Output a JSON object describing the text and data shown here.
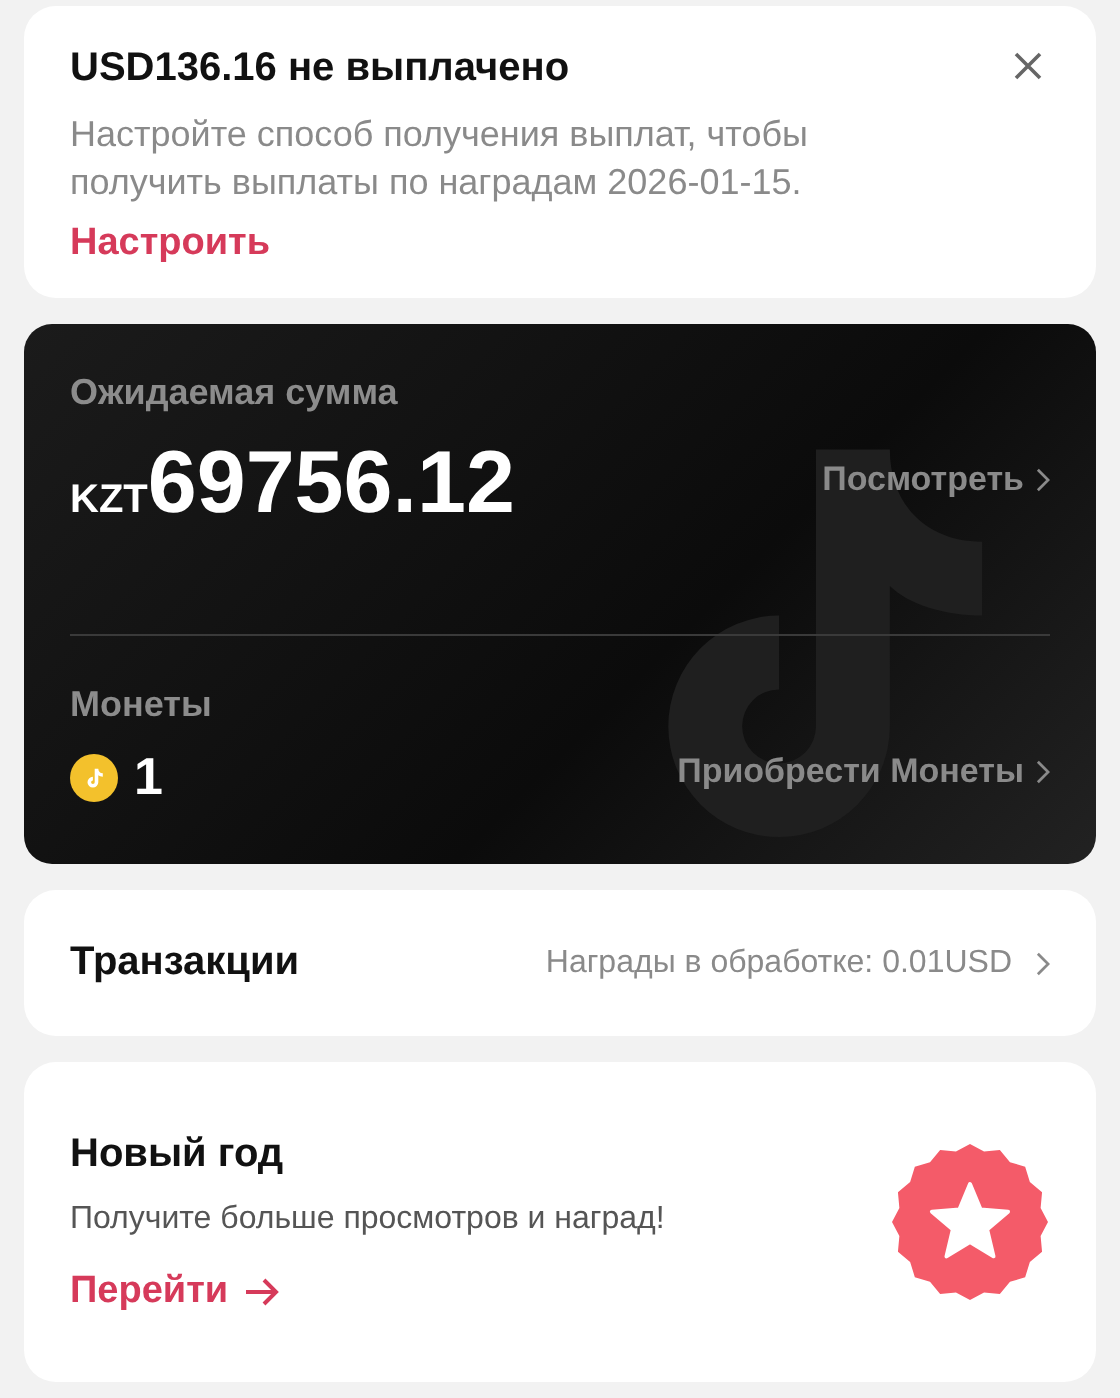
{
  "payout_notice": {
    "title": "USD136.16 не выплачено",
    "message": "Настройте способ получения выплат, чтобы получить выплаты по наградам 2026-01-15.",
    "action": "Настроить"
  },
  "balance": {
    "label": "Ожидаемая сумма",
    "currency": "KZT",
    "amount": "69756.12",
    "view_link": "Посмотреть",
    "coins_label": "Монеты",
    "coins": "1",
    "buy_link": "Приобрести Монеты"
  },
  "transactions": {
    "title": "Транзакции",
    "pending": "Награды в обработке: 0.01USD"
  },
  "promo": {
    "title": "Новый год",
    "message": "Получите больше просмотров и наград!",
    "action": "Перейти"
  }
}
